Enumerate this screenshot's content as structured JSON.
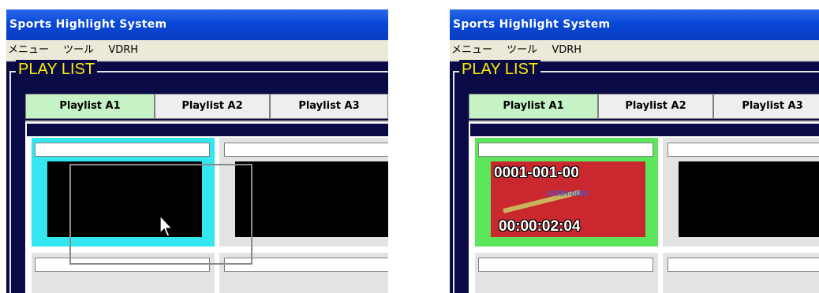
{
  "windows": [
    {
      "title": "Sports Highlight System",
      "menu": [
        "メニュー",
        "ツール",
        "VDRH"
      ],
      "section_label": "PLAY LIST",
      "tabs": [
        "Playlist A1",
        "Playlist A2",
        "Playlist A3"
      ],
      "active_tab": "Playlist A1",
      "first_tile_state": "selected-empty"
    },
    {
      "title": "Sports Highlight System",
      "menu": [
        "メニュー",
        "ツール",
        "VDRH"
      ],
      "section_label": "PLAY LIST",
      "tabs": [
        "Playlist A1",
        "Playlist A2",
        "Playlist A3"
      ],
      "active_tab": "Playlist A1",
      "first_tile_state": "clip-loaded",
      "clip": {
        "id": "0001-001-00",
        "source": "VDRH-0000",
        "timecode": "00:00:02:04"
      }
    }
  ],
  "colors": {
    "titlebar": "#0a3cc0",
    "panel_bg": "#0a0a46",
    "section_label": "#ffee00",
    "active_tab": "#c6f3c6",
    "selected_tile_left": "#33e6f0",
    "selected_tile_right": "#5be65b",
    "clip_bg": "#c8282e"
  }
}
